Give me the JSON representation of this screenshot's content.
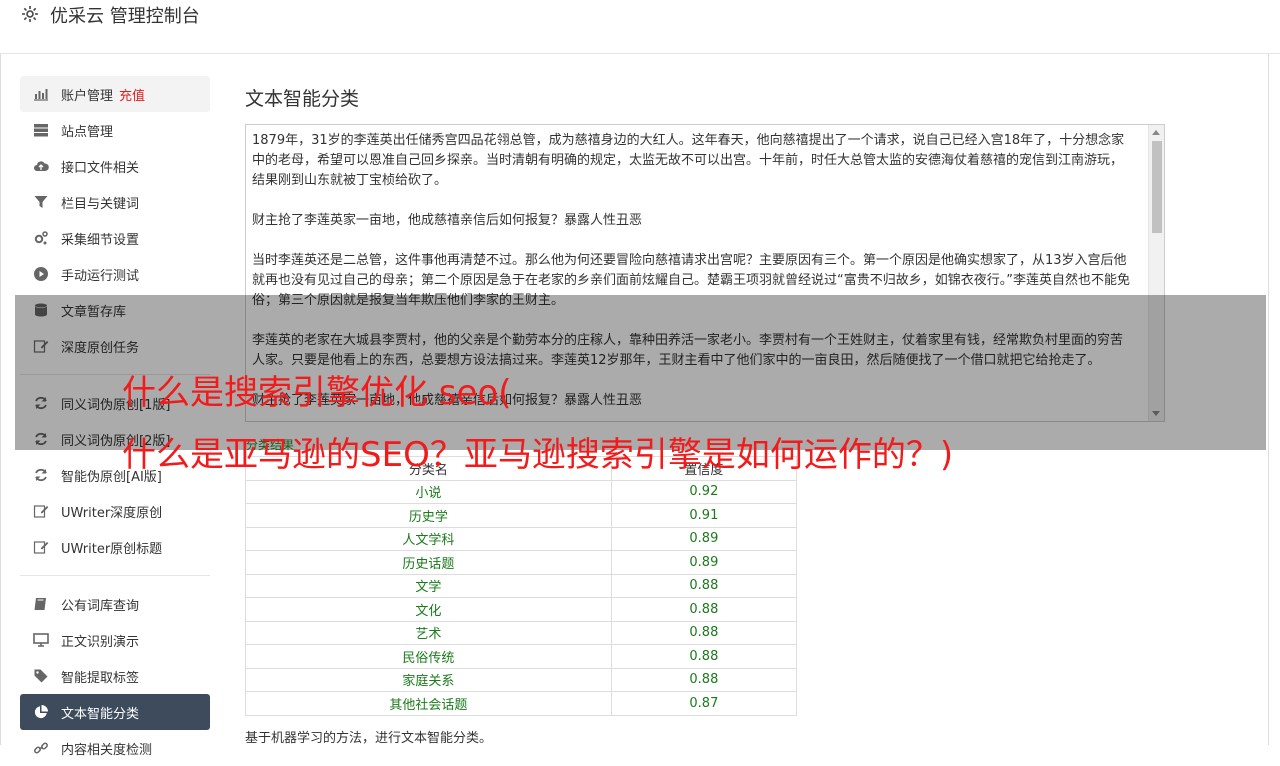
{
  "app": {
    "title": "优采云 管理控制台",
    "icon": "gear-icon"
  },
  "sidebar": {
    "groups": [
      [
        {
          "label": "账户管理",
          "extra": "充值",
          "icon": "bar-chart-icon"
        },
        {
          "label": "站点管理",
          "icon": "server-icon"
        },
        {
          "label": "接口文件相关",
          "icon": "cloud-upload-icon"
        },
        {
          "label": "栏目与关键词",
          "icon": "filter-icon"
        },
        {
          "label": "采集细节设置",
          "icon": "cogs-icon"
        },
        {
          "label": "手动运行测试",
          "icon": "play-circle-icon"
        },
        {
          "label": "文章暂存库",
          "icon": "database-icon"
        },
        {
          "label": "深度原创任务",
          "icon": "edit-icon"
        }
      ],
      [
        {
          "label": "同义词伪原创[1版]",
          "icon": "refresh-icon"
        },
        {
          "label": "同义词伪原创[2版]",
          "icon": "refresh-icon"
        },
        {
          "label": "智能伪原创[AI版]",
          "icon": "refresh-icon"
        },
        {
          "label": "UWriter深度原创",
          "icon": "edit-icon"
        },
        {
          "label": "UWriter原创标题",
          "icon": "edit-icon"
        }
      ],
      [
        {
          "label": "公有词库查询",
          "icon": "book-icon"
        },
        {
          "label": "正文识别演示",
          "icon": "monitor-icon"
        },
        {
          "label": "智能提取标签",
          "icon": "tag-icon"
        },
        {
          "label": "文本智能分类",
          "icon": "pie-chart-icon",
          "active": true
        },
        {
          "label": "内容相关度检测",
          "icon": "link-icon"
        }
      ]
    ]
  },
  "main": {
    "title": "文本智能分类",
    "text_paragraphs": [
      "1879年，31岁的李莲英出任储秀宫四品花翎总管，成为慈禧身边的大红人。这年春天，他向慈禧提出了一个请求，说自己已经入宫18年了，十分想念家中的老母，希望可以恩准自己回乡探亲。当时清朝有明确的规定，太监无故不可以出宫。十年前，时任大总管太监的安德海仗着慈禧的宠信到江南游玩，结果刚到山东就被丁宝桢给砍了。",
      "财主抢了李莲英家一亩地，他成慈禧亲信后如何报复？暴露人性丑恶",
      "当时李莲英还是二总管，这件事他再清楚不过。那么他为何还要冒险向慈禧请求出宫呢？主要原因有三个。第一个原因是他确实想家了，从13岁入宫后他就再也没有见过自己的母亲；第二个原因是急于在老家的乡亲们面前炫耀自己。楚霸王项羽就曾经说过“富贵不归故乡，如锦衣夜行。”李莲英自然也不能免俗；第三个原因就是报复当年欺压他们李家的王财主。",
      "李莲英的老家在大城县李贾村，他的父亲是个勤劳本分的庄稼人，靠种田养活一家老小。李贾村有一个王姓财主，仗着家里有钱，经常欺负村里面的穷苦人家。只要是他看上的东西，总要想方设法搞过来。李莲英12岁那年，王财主看中了他们家中的一亩良田，然后随便找了一个借口就把它给抢走了。",
      "财主抢了李莲英家一亩地，他成慈禧亲信后如何报复？暴露人性丑恶"
    ],
    "results_label": "分类结果",
    "table": {
      "headers": [
        "分类名",
        "置信度"
      ],
      "rows": [
        [
          "小说",
          "0.92"
        ],
        [
          "历史学",
          "0.91"
        ],
        [
          "人文学科",
          "0.89"
        ],
        [
          "历史话题",
          "0.89"
        ],
        [
          "文学",
          "0.88"
        ],
        [
          "文化",
          "0.88"
        ],
        [
          "艺术",
          "0.88"
        ],
        [
          "民俗传统",
          "0.88"
        ],
        [
          "家庭关系",
          "0.88"
        ],
        [
          "其他社会话题",
          "0.87"
        ]
      ]
    },
    "footnote": "基于机器学习的方法，进行文本智能分类。"
  },
  "overlay": {
    "line1": "什么是搜索引擎优化 seo(",
    "line2": "什么是亚马逊的SEO？亚马逊搜索引擎是如何运作的？)"
  },
  "colors": {
    "active_bg": "#3d4b5c",
    "accent_red": "#e02020",
    "result_green": "#1a7a1a",
    "overlay_text": "#f21a1a"
  }
}
